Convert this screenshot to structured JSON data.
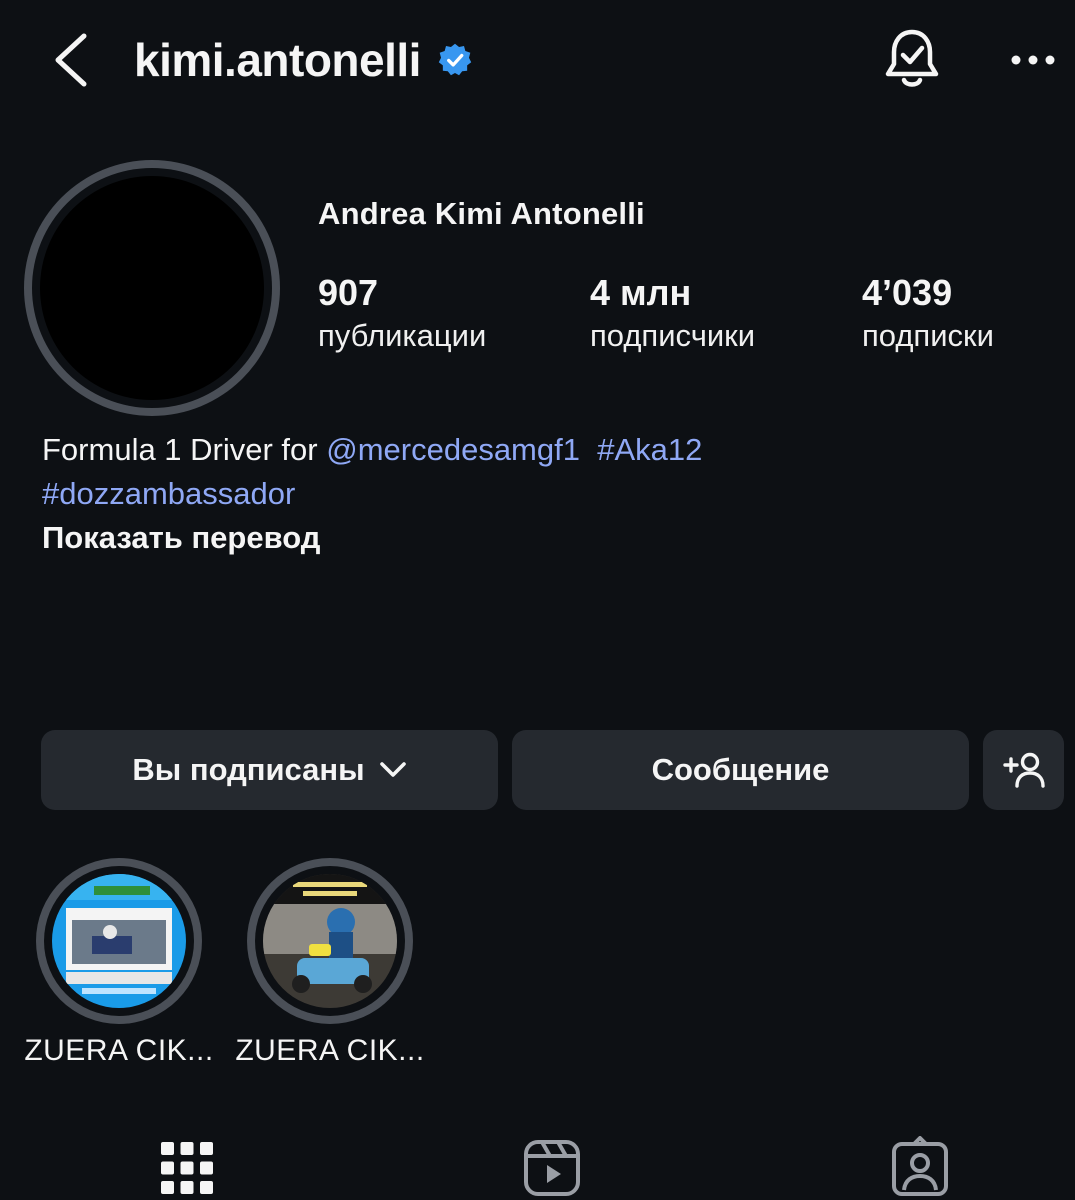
{
  "header": {
    "username": "kimi.antonelli",
    "back_icon": "chevron-left-icon",
    "verified_icon": "verified-badge-icon",
    "bell_icon": "notification-bell-check-icon",
    "more_icon": "more-horizontal-icon"
  },
  "profile": {
    "full_name": "Andrea Kimi Antonelli",
    "stats": {
      "posts": {
        "value": "907",
        "label": "публикации"
      },
      "followers": {
        "value": "4 млн",
        "label": "подписчики"
      },
      "following": {
        "value": "4’039",
        "label": "подписки"
      }
    }
  },
  "bio": {
    "text_prefix": "Formula 1 Driver for ",
    "mention": "@mercedesamgf1",
    "hashtag1": "#Aka12",
    "hashtag2": "#dozzambassador",
    "translate_label": "Показать перевод"
  },
  "actions": {
    "following_label": "Вы подписаны",
    "message_label": "Сообщение",
    "add_user_icon": "add-person-icon"
  },
  "highlights": [
    {
      "label": "ZUERA CIK..."
    },
    {
      "label": "ZUERA CIK..."
    }
  ],
  "tabs": {
    "grid_icon": "grid-icon",
    "reels_icon": "reels-icon",
    "tagged_icon": "tagged-person-icon"
  },
  "colors": {
    "background": "#0d1014",
    "button": "#25292f",
    "link": "#8fa8f5",
    "verified": "#3897f0"
  }
}
